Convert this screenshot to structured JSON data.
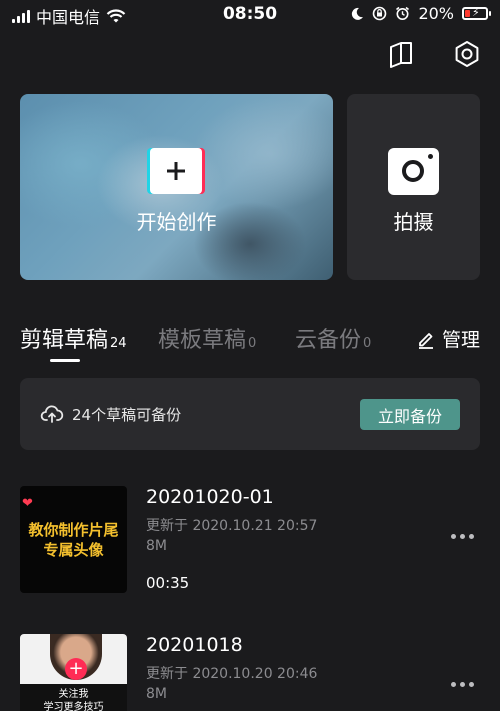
{
  "status_bar": {
    "carrier": "中国电信",
    "time": "08:50",
    "battery_percent": "20%",
    "battery_level": 0.2
  },
  "top_actions": {
    "left_icon": "book-icon",
    "right_icon": "settings-hexagon-icon"
  },
  "create_card": {
    "label": "开始创作",
    "icon": "plus-icon"
  },
  "shoot_card": {
    "label": "拍摄",
    "icon": "camera-icon"
  },
  "tabs": [
    {
      "label": "剪辑草稿",
      "count": "24",
      "active": true
    },
    {
      "label": "模板草稿",
      "count": "0",
      "active": false
    },
    {
      "label": "云备份",
      "count": "0",
      "active": false
    }
  ],
  "manage": {
    "label": "管理",
    "icon": "edit-icon"
  },
  "backup": {
    "text": "24个草稿可备份",
    "button": "立即备份",
    "icon": "cloud-upload-icon",
    "accent": "#4e958b"
  },
  "drafts": [
    {
      "title": "20201020-01",
      "updated": "更新于 2020.10.21 20:57",
      "size": "8M",
      "duration": "00:35",
      "thumb_text_line1": "教你制作片尾",
      "thumb_text_line2": "专属头像"
    },
    {
      "title": "20201018",
      "updated": "更新于 2020.10.20 20:46",
      "size": "8M",
      "thumb_text_line1": "关注我",
      "thumb_text_line2": "学习更多技巧"
    }
  ]
}
